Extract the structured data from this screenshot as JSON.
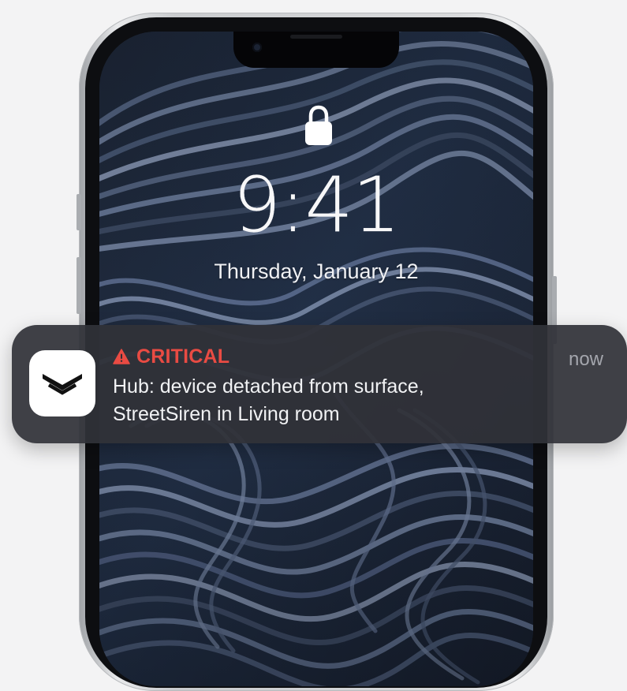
{
  "lock_screen": {
    "time": "9:41",
    "date": "Thursday, January 12"
  },
  "notification": {
    "header_label": "CRITICAL",
    "timestamp": "now",
    "message_line_1": "Hub: device detached from surface,",
    "message_line_2": "StreetSiren in Living room"
  },
  "icons": {
    "lock": "lock-icon",
    "warning": "warning-triangle-icon",
    "app": "app-logo-icon"
  },
  "colors": {
    "critical_red": "#e94b43",
    "notification_background": "#303138",
    "time_text": "#f7f7f8",
    "secondary_text": "#a4a6ad"
  }
}
